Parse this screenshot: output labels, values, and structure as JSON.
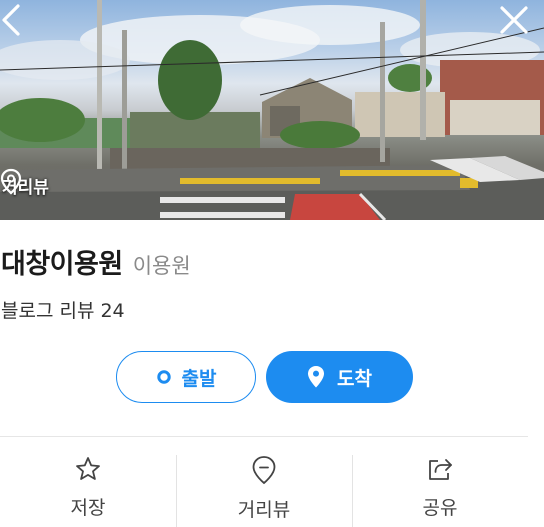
{
  "header": {
    "back_icon": "chevron-left-icon",
    "close_icon": "close-icon"
  },
  "roadview": {
    "label": "거리뷰",
    "icon": "map-pin-icon"
  },
  "place": {
    "name": "대창이용원",
    "category": "이용원"
  },
  "reviews": {
    "label": "블로그 리뷰",
    "count": "24"
  },
  "route": {
    "depart_label": "출발",
    "arrive_label": "도착"
  },
  "actions": {
    "save_label": "저장",
    "roadview_label": "거리뷰",
    "share_label": "공유"
  },
  "colors": {
    "accent": "#1d8cf0",
    "text_primary": "#1b1b1b",
    "text_secondary": "#8a8a8a"
  }
}
